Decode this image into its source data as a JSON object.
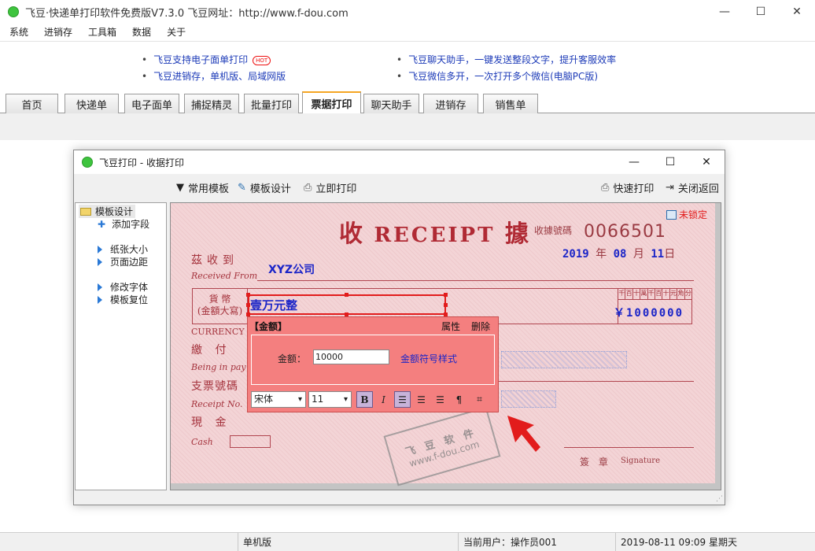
{
  "app": {
    "title": "飞豆·快递单打印软件免费版V7.3.0  飞豆网址：http://www.f-dou.com",
    "window_controls": [
      "—",
      "☐",
      "✕"
    ]
  },
  "menu": [
    "系统",
    "进销存",
    "工具箱",
    "数据",
    "关于"
  ],
  "ads": {
    "left": [
      "飞豆支持电子面单打印",
      "飞豆进销存，单机版、局域网版"
    ],
    "hot_badge": "HOT",
    "right": [
      "飞豆聊天助手，一键发送整段文字，提升客服效率",
      "飞豆微信多开，一次打开多个微信(电脑PC版)"
    ]
  },
  "tabs": [
    "首页",
    "快递单",
    "电子面单",
    "捕捉精灵",
    "批量打印",
    "票据打印",
    "聊天助手",
    "进销存",
    "销售单"
  ],
  "active_tab": "票据打印",
  "dialog": {
    "title": "飞豆打印 - 收据打印",
    "toolbar": {
      "common_templates": "常用模板",
      "template_design": "模板设计",
      "print_now": "立即打印",
      "quick_print": "快速打印",
      "close_return": "关闭返回"
    },
    "tree": {
      "root": "模板设计",
      "add_field": "添加字段",
      "paper_size": "纸张大小",
      "page_margin": "页面边距",
      "edit_font": "修改字体",
      "reset_template": "模板复位"
    }
  },
  "receipt": {
    "title_left": "收",
    "title_en": "RECEIPT",
    "title_right": "據",
    "number_label": "收據號碼",
    "number": "0066501",
    "date": {
      "year": "2019",
      "year_unit": "年",
      "month": "08",
      "month_unit": "月",
      "day": "11",
      "day_unit": "日"
    },
    "lock_status": "未锁定",
    "received_from_cn": "茲收到",
    "received_from_en": "Received From",
    "payee": "XYZ公司",
    "currency_cn_1": "貨 幣",
    "currency_cn_2": "(金額大寫)",
    "currency_en": "CURRENCY",
    "amount_words": "壹万元整",
    "digit_headers": [
      "千",
      "百",
      "十",
      "萬",
      "千",
      "百",
      "十",
      "元",
      "角",
      "分"
    ],
    "amount_figures": "￥1000000",
    "payment_cn": "繳 付",
    "payment_en": "Being in pay",
    "cheque_no": "支票號碼",
    "receipt_no_en": "Receipt No.",
    "cash_cn": "現 金",
    "cash_en": "Cash",
    "signature_cn": "簽 章",
    "signature_en": "Signature",
    "watermark_1": "飞 豆 软 件",
    "watermark_2": "www.f-dou.com"
  },
  "editor": {
    "header": "【金额】",
    "properties": "属性",
    "delete": "删除",
    "amount_label": "金额：",
    "amount_value": "10000",
    "currency_style": "金额符号样式",
    "font_name": "宋体",
    "font_size": "11",
    "bold": "B",
    "italic": "I"
  },
  "status": {
    "mode": "单机版",
    "user": "当前用户：操作员001",
    "datetime": "2019-08-11 09:09 星期天"
  },
  "colors": {
    "accent_tab": "#f5a623",
    "receipt_bg": "#f3d4d6",
    "receipt_ink": "#b02a34",
    "fill_ink": "#1b25c8",
    "editor_bg": "#f47f7f",
    "pointer_arrow": "#e21c1c"
  }
}
